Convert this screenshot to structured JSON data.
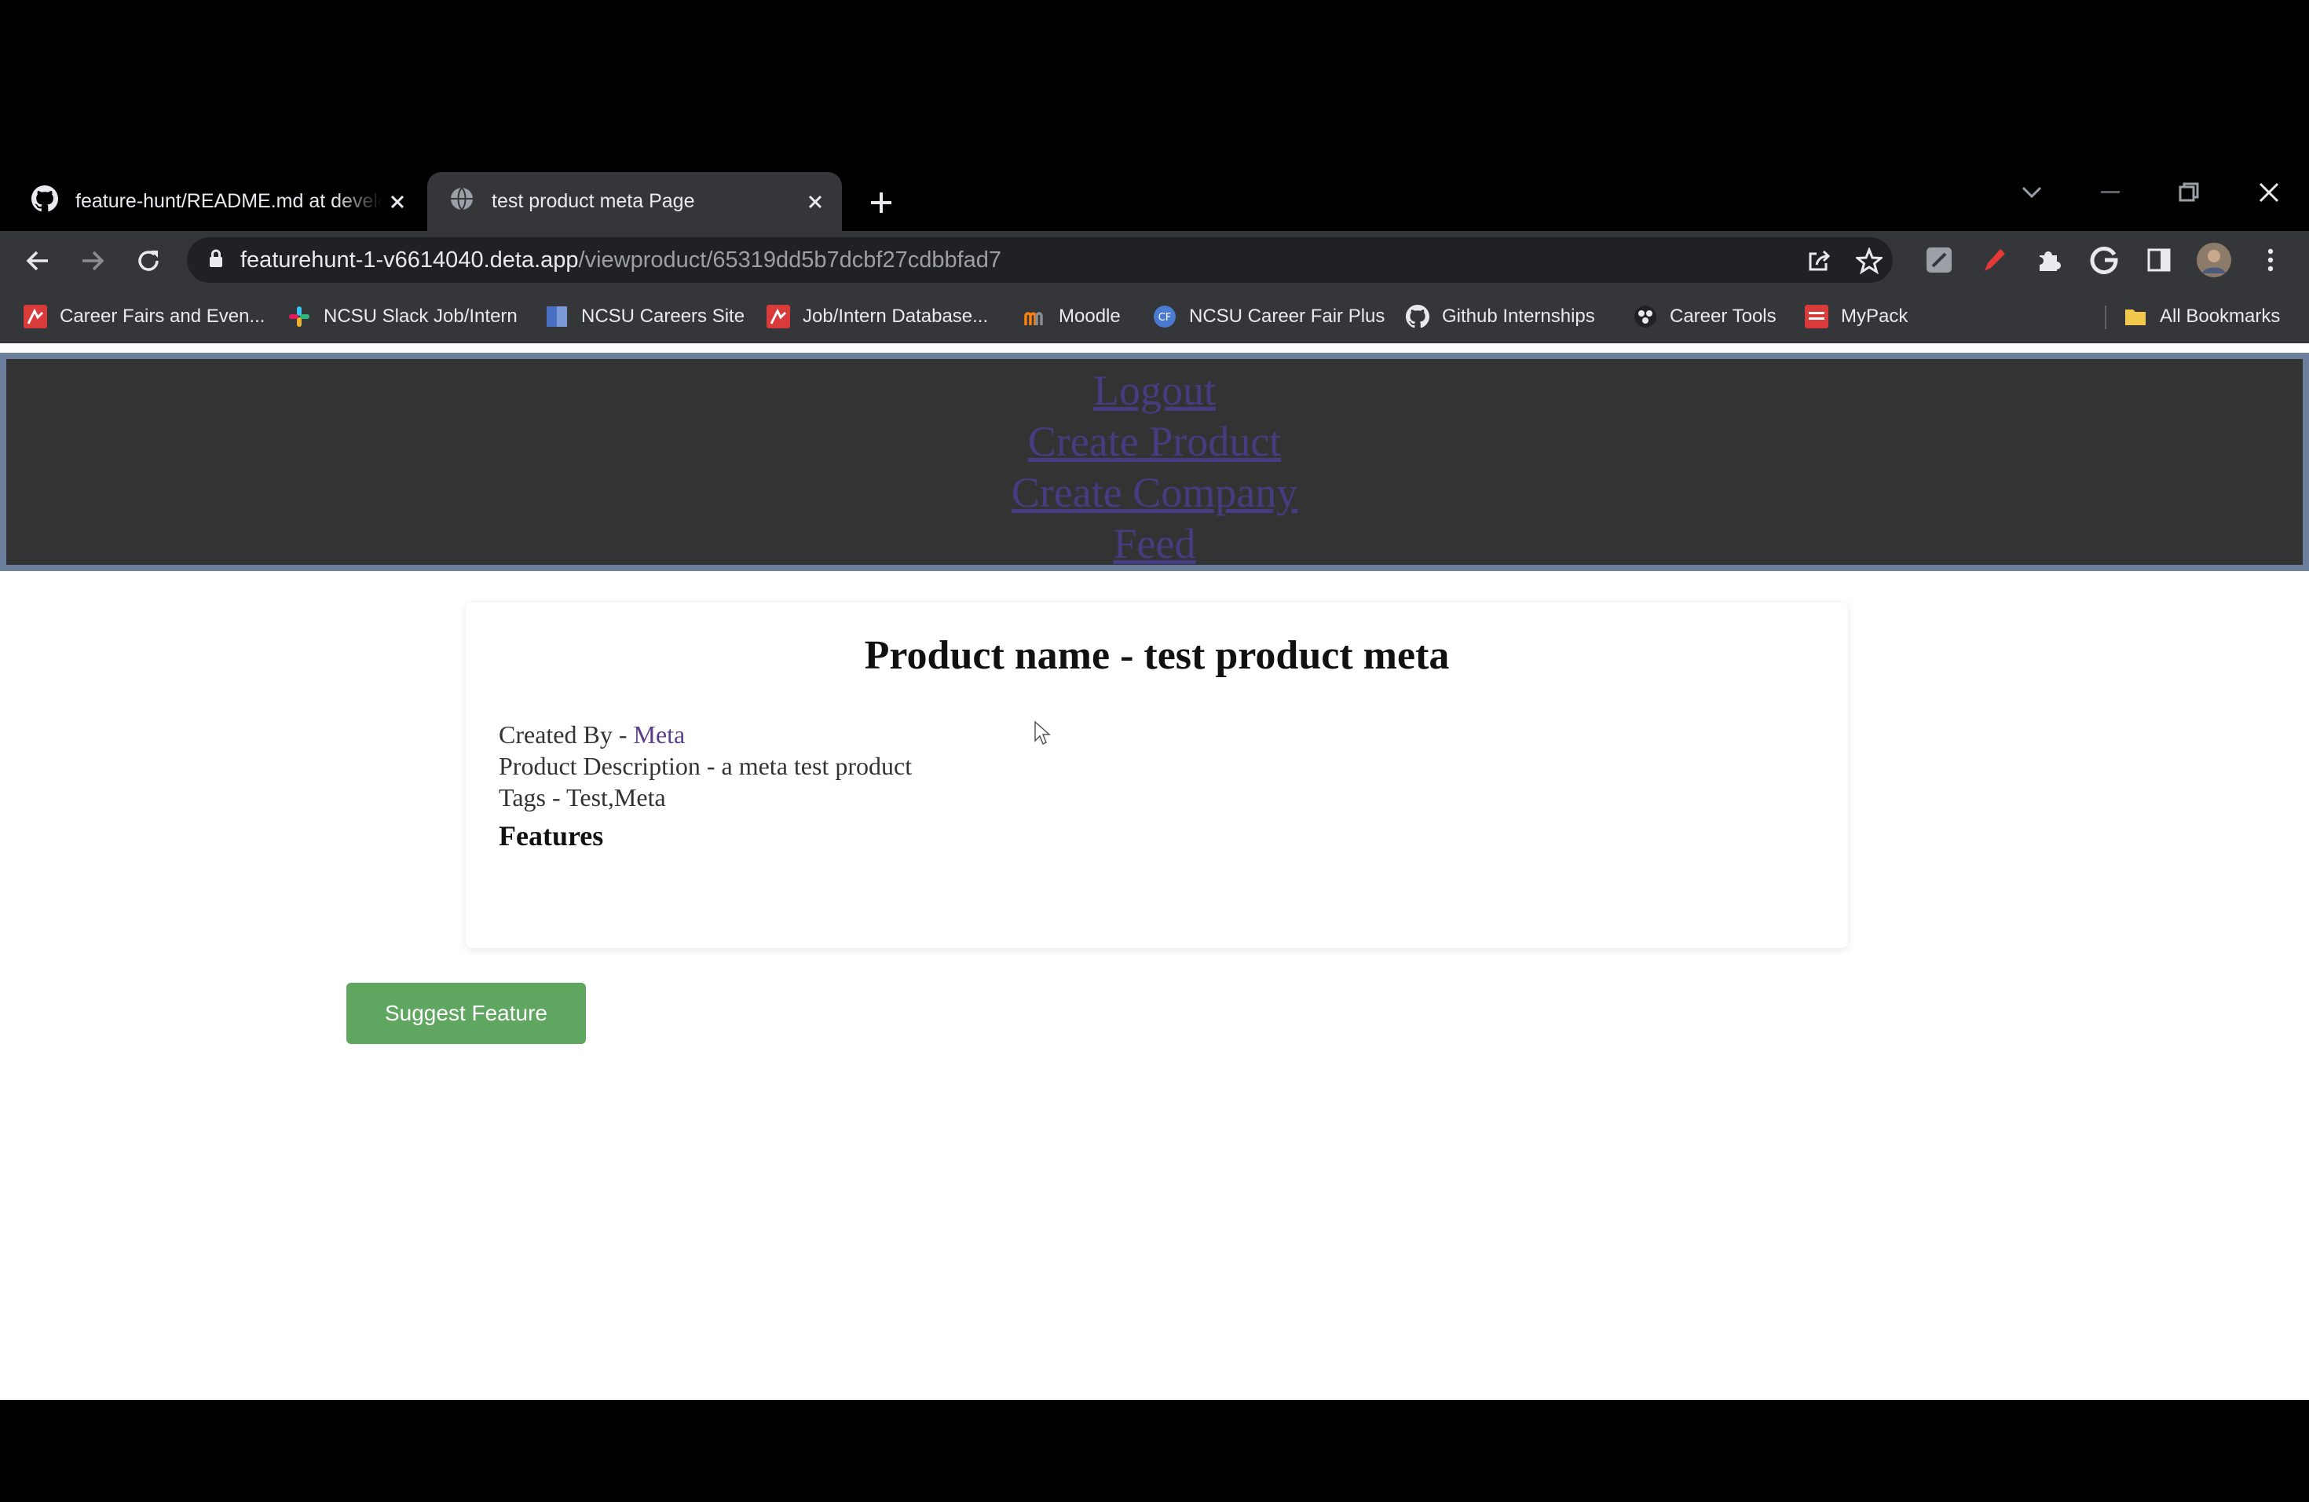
{
  "browser": {
    "tabs": [
      {
        "title": "feature-hunt/README.md at develo",
        "icon": "github-icon",
        "active": false
      },
      {
        "title": "test product meta Page",
        "icon": "globe-icon",
        "active": true
      }
    ],
    "new_tab_symbol": "+",
    "address_bar": {
      "domain": "featurehunt-1-v6614040.deta.app",
      "path": "/viewproduct/65319dd5b7dcbf27cdbbfad7"
    },
    "bookmarks": [
      {
        "label": "Career Fairs and Even...",
        "icon": "handshake-icon"
      },
      {
        "label": "NCSU Slack Job/Intern",
        "icon": "slack-icon"
      },
      {
        "label": "NCSU Careers Site",
        "icon": "page-icon"
      },
      {
        "label": "Job/Intern Database...",
        "icon": "handshake-icon"
      },
      {
        "label": "Moodle",
        "icon": "moodle-icon"
      },
      {
        "label": "NCSU Career Fair Plus",
        "icon": "cf-icon"
      },
      {
        "label": "Github Internships",
        "icon": "github-icon"
      },
      {
        "label": "Career Tools",
        "icon": "tools-icon"
      },
      {
        "label": "MyPack",
        "icon": "mypack-icon"
      }
    ],
    "all_bookmarks_label": "All Bookmarks"
  },
  "site_nav": {
    "links": [
      "Logout",
      "Create Product",
      "Create Company",
      "Feed"
    ]
  },
  "product": {
    "heading": "Product name - test product meta",
    "created_by_label": "Created By - ",
    "created_by_value": "Meta",
    "description": "Product Description - a meta test product",
    "tags": "Tags - Test,Meta",
    "features_heading": "Features"
  },
  "actions": {
    "suggest_feature": "Suggest Feature"
  },
  "colors": {
    "nav_background": "#333333",
    "nav_border": "#6b7f9c",
    "button_green": "#5fa660"
  }
}
